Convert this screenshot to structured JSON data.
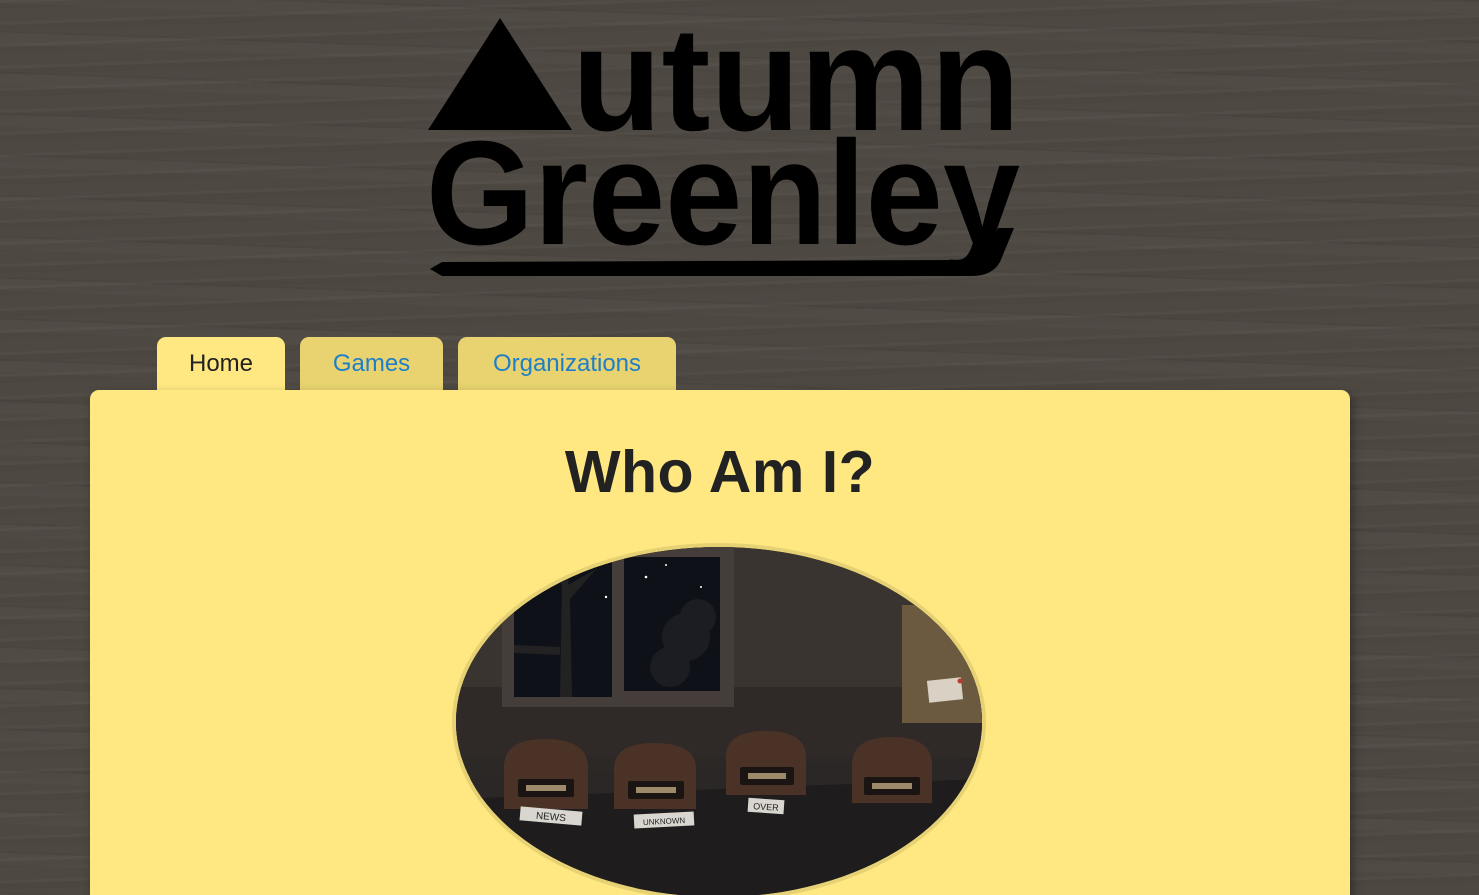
{
  "site": {
    "logo_line1": "utumn",
    "logo_line2": "Greenley",
    "logo_alt": "Autumn Greenley"
  },
  "nav": {
    "tabs": [
      {
        "label": "Home",
        "active": true
      },
      {
        "label": "Games",
        "active": false
      },
      {
        "label": "Organizations",
        "active": false
      }
    ]
  },
  "main": {
    "title": "Who Am I?",
    "hero_labels": [
      "NEWS",
      "UNKNOWN",
      "OVER"
    ]
  },
  "colors": {
    "background": "#4e4842",
    "panel": "#ffe882",
    "tab_inactive": "#e8d370",
    "link": "#1e7fc7",
    "text": "#222222"
  },
  "icons": {
    "logo_mark": "triangle-a-mark"
  }
}
